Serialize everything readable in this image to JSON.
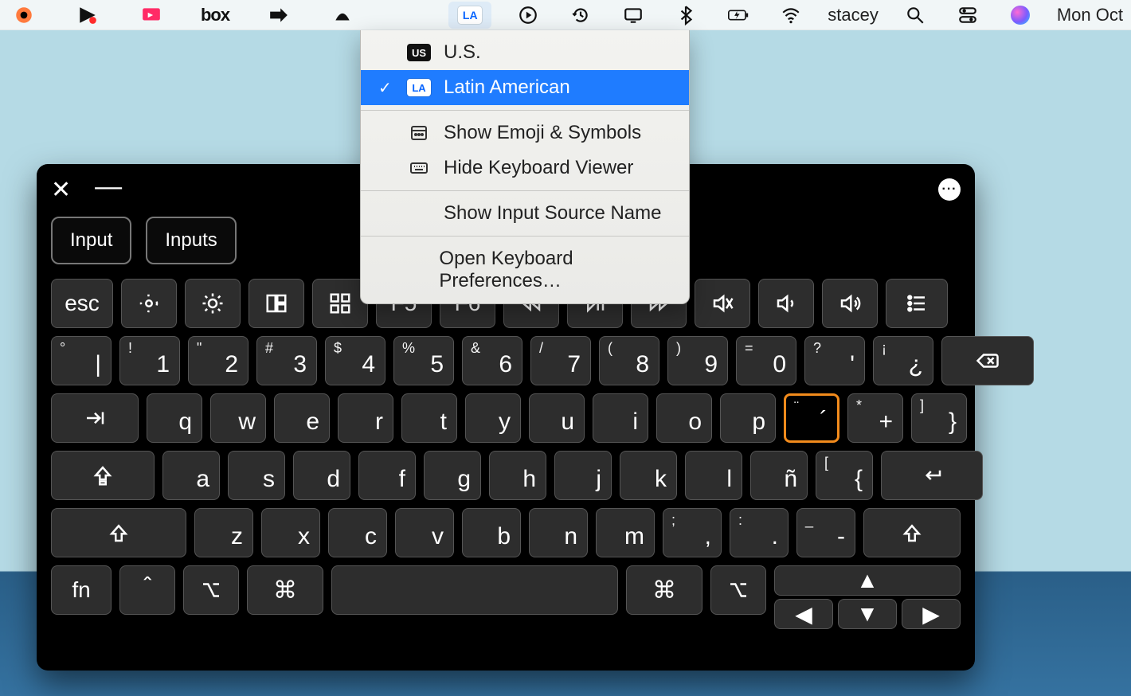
{
  "menubar": {
    "username": "stacey",
    "clock": "Mon Oct",
    "input_badge": "LA",
    "box_label": "box"
  },
  "dropdown": {
    "items": [
      {
        "tag": "US",
        "label": "U.S.",
        "selected": false
      },
      {
        "tag": "LA",
        "label": "Latin American",
        "selected": true
      }
    ],
    "show_emoji": "Show Emoji & Symbols",
    "hide_kb": "Hide Keyboard Viewer",
    "show_source_name": "Show Input Source Name",
    "open_prefs": "Open Keyboard Preferences…"
  },
  "keyboard": {
    "suggestions": [
      "Input",
      "Inputs"
    ],
    "fn_row": {
      "esc": "esc",
      "f5": "F5",
      "f6": "F6"
    },
    "row1": [
      {
        "tl": "°",
        "br": "|"
      },
      {
        "tl": "!",
        "br": "1"
      },
      {
        "tl": "\"",
        "br": "2"
      },
      {
        "tl": "#",
        "br": "3"
      },
      {
        "tl": "$",
        "br": "4"
      },
      {
        "tl": "%",
        "br": "5"
      },
      {
        "tl": "&",
        "br": "6"
      },
      {
        "tl": "/",
        "br": "7"
      },
      {
        "tl": "(",
        "br": "8"
      },
      {
        "tl": ")",
        "br": "9"
      },
      {
        "tl": "=",
        "br": "0"
      },
      {
        "tl": "?",
        "br": "'"
      },
      {
        "tl": "¡",
        "br": "¿"
      }
    ],
    "row2": [
      {
        "br": "q"
      },
      {
        "br": "w"
      },
      {
        "br": "e"
      },
      {
        "br": "r"
      },
      {
        "br": "t"
      },
      {
        "br": "y"
      },
      {
        "br": "u"
      },
      {
        "br": "i"
      },
      {
        "br": "o"
      },
      {
        "br": "p"
      },
      {
        "tl": "¨",
        "br": "´",
        "hit": true
      },
      {
        "tl": "*",
        "br": "+"
      },
      {
        "tl": "]",
        "br": "}"
      }
    ],
    "row3": [
      {
        "br": "a"
      },
      {
        "br": "s"
      },
      {
        "br": "d"
      },
      {
        "br": "f"
      },
      {
        "br": "g"
      },
      {
        "br": "h"
      },
      {
        "br": "j"
      },
      {
        "br": "k"
      },
      {
        "br": "l"
      },
      {
        "br": "ñ"
      },
      {
        "tl": "[",
        "br": "{"
      }
    ],
    "row4": [
      {
        "br": "z"
      },
      {
        "br": "x"
      },
      {
        "br": "c"
      },
      {
        "br": "v"
      },
      {
        "br": "b"
      },
      {
        "br": "n"
      },
      {
        "br": "m"
      },
      {
        "tl": ";",
        "br": ","
      },
      {
        "tl": ":",
        "br": "."
      },
      {
        "tl": "_",
        "br": "-"
      }
    ],
    "row5": {
      "fn": "fn"
    }
  }
}
